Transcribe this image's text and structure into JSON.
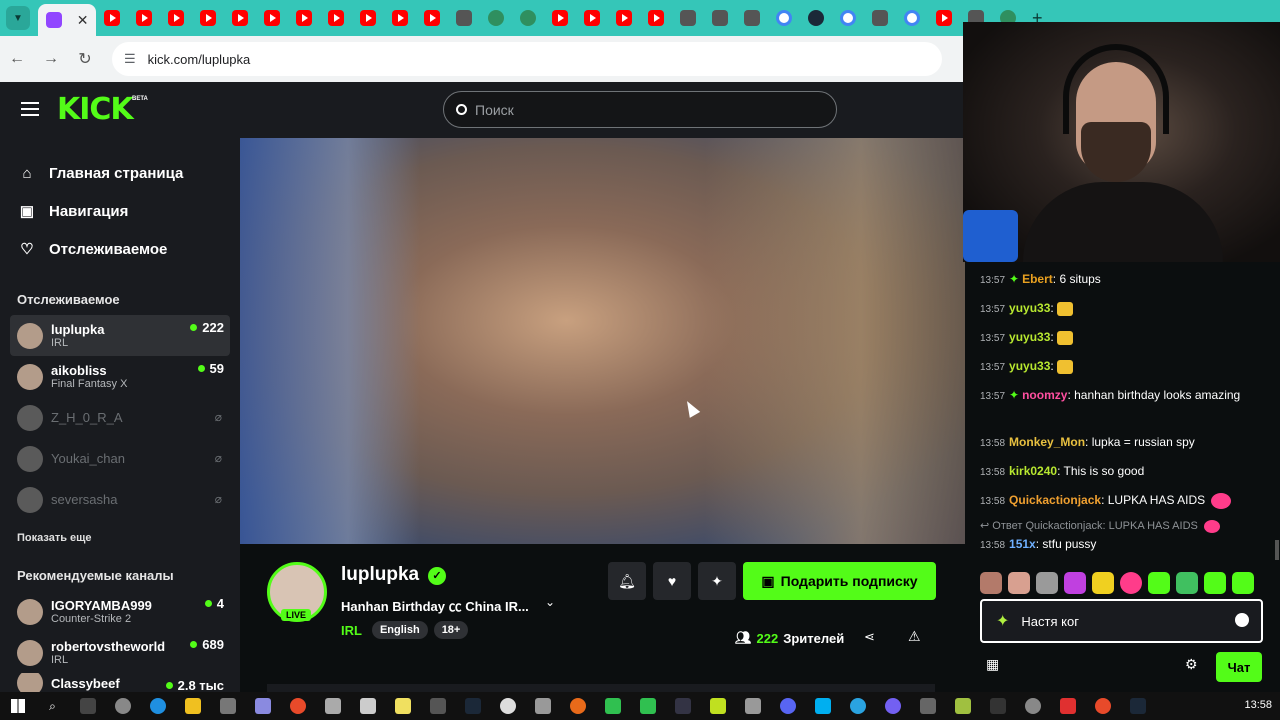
{
  "browser": {
    "url": "kick.com/luplupka",
    "new_tab_icon": "plus",
    "tab_icons": [
      "twitch",
      "youtube",
      "youtube",
      "youtube",
      "youtube",
      "youtube",
      "youtube",
      "youtube",
      "youtube",
      "youtube",
      "youtube",
      "youtube",
      "misc",
      "github",
      "misc",
      "youtube",
      "youtube",
      "youtube",
      "youtube",
      "misc",
      "misc",
      "translate",
      "google",
      "steam",
      "google",
      "misc",
      "google",
      "adblock",
      "misc",
      "misc"
    ]
  },
  "kick": {
    "logo": "KICK",
    "logo_badge": "BETA",
    "search_placeholder": "Поиск",
    "main_nav": [
      {
        "icon": "home-icon",
        "label": "Главная страница"
      },
      {
        "icon": "browse-icon",
        "label": "Навигация"
      },
      {
        "icon": "heart-icon",
        "label": "Отслеживаемое"
      }
    ],
    "following_title": "Отслеживаемое",
    "following": [
      {
        "name": "luplupka",
        "category": "IRL",
        "viewers": "222",
        "live": true
      },
      {
        "name": "aikobliss",
        "category": "Final Fantasy X",
        "viewers": "59",
        "live": true
      },
      {
        "name": "Z_H_0_R_A",
        "category": "",
        "viewers": "",
        "live": false
      },
      {
        "name": "Youkai_chan",
        "category": "",
        "viewers": "",
        "live": false
      },
      {
        "name": "seversasha",
        "category": "",
        "viewers": "",
        "live": false
      }
    ],
    "show_more": "Показать еще",
    "recommended_title": "Рекомендуемые каналы",
    "recommended": [
      {
        "name": "IGORYAMBA999",
        "category": "Counter-Strike 2",
        "viewers": "4"
      },
      {
        "name": "robertovstheworld",
        "category": "IRL",
        "viewers": "689"
      },
      {
        "name": "Classybeef",
        "category": "",
        "viewers": "2.8 тыс"
      }
    ],
    "channel": {
      "name": "luplupka",
      "live_badge": "LIVE",
      "stream_title": "Hanhan Birthday ㏄ China IR...",
      "category": "IRL",
      "tags": [
        "English",
        "18+"
      ],
      "gift_sub_label": "Подарить подписку",
      "viewers": "222",
      "viewers_label": "Зрителей"
    }
  },
  "chat": {
    "messages": [
      {
        "time": "13:57",
        "badge": true,
        "user": "Ebert",
        "color": "#e8a020",
        "text": "6 situps"
      },
      {
        "time": "13:57",
        "badge": false,
        "user": "yuyu33",
        "color": "#b8e830",
        "text": "",
        "emote": "you tried"
      },
      {
        "time": "13:57",
        "badge": false,
        "user": "yuyu33",
        "color": "#b8e830",
        "text": "",
        "emote": "you tried"
      },
      {
        "time": "13:57",
        "badge": false,
        "user": "yuyu33",
        "color": "#b8e830",
        "text": "",
        "emote": "you tried"
      },
      {
        "time": "13:57",
        "badge": true,
        "user": "noomzy",
        "color": "#ff4fa0",
        "text": "hanhan birthday looks amazing"
      },
      {
        "time": "13:58",
        "badge": false,
        "user": "Monkey_Mon",
        "color": "#e8c040",
        "text": "lupka = russian spy"
      },
      {
        "time": "13:58",
        "badge": false,
        "user": "kirk0240",
        "color": "#b8e830",
        "text": "This is so good"
      },
      {
        "time": "13:58",
        "badge": false,
        "user": "Quickactionjack",
        "color": "#f0a030",
        "text": "LUPKA HAS AIDS"
      },
      {
        "time": "13:58",
        "badge": false,
        "user": "151x",
        "color": "#6fb0ff",
        "text": "stfu pussy"
      }
    ],
    "reply_label": "Ответ Quickactionjack: LUPKA HAS AIDS",
    "input_value": "Настя ког",
    "send_label": "Чат"
  },
  "taskbar": {
    "time": "13:58"
  },
  "colors": {
    "brand_green": "#53fc18",
    "tabstrip": "#35c6b8"
  }
}
